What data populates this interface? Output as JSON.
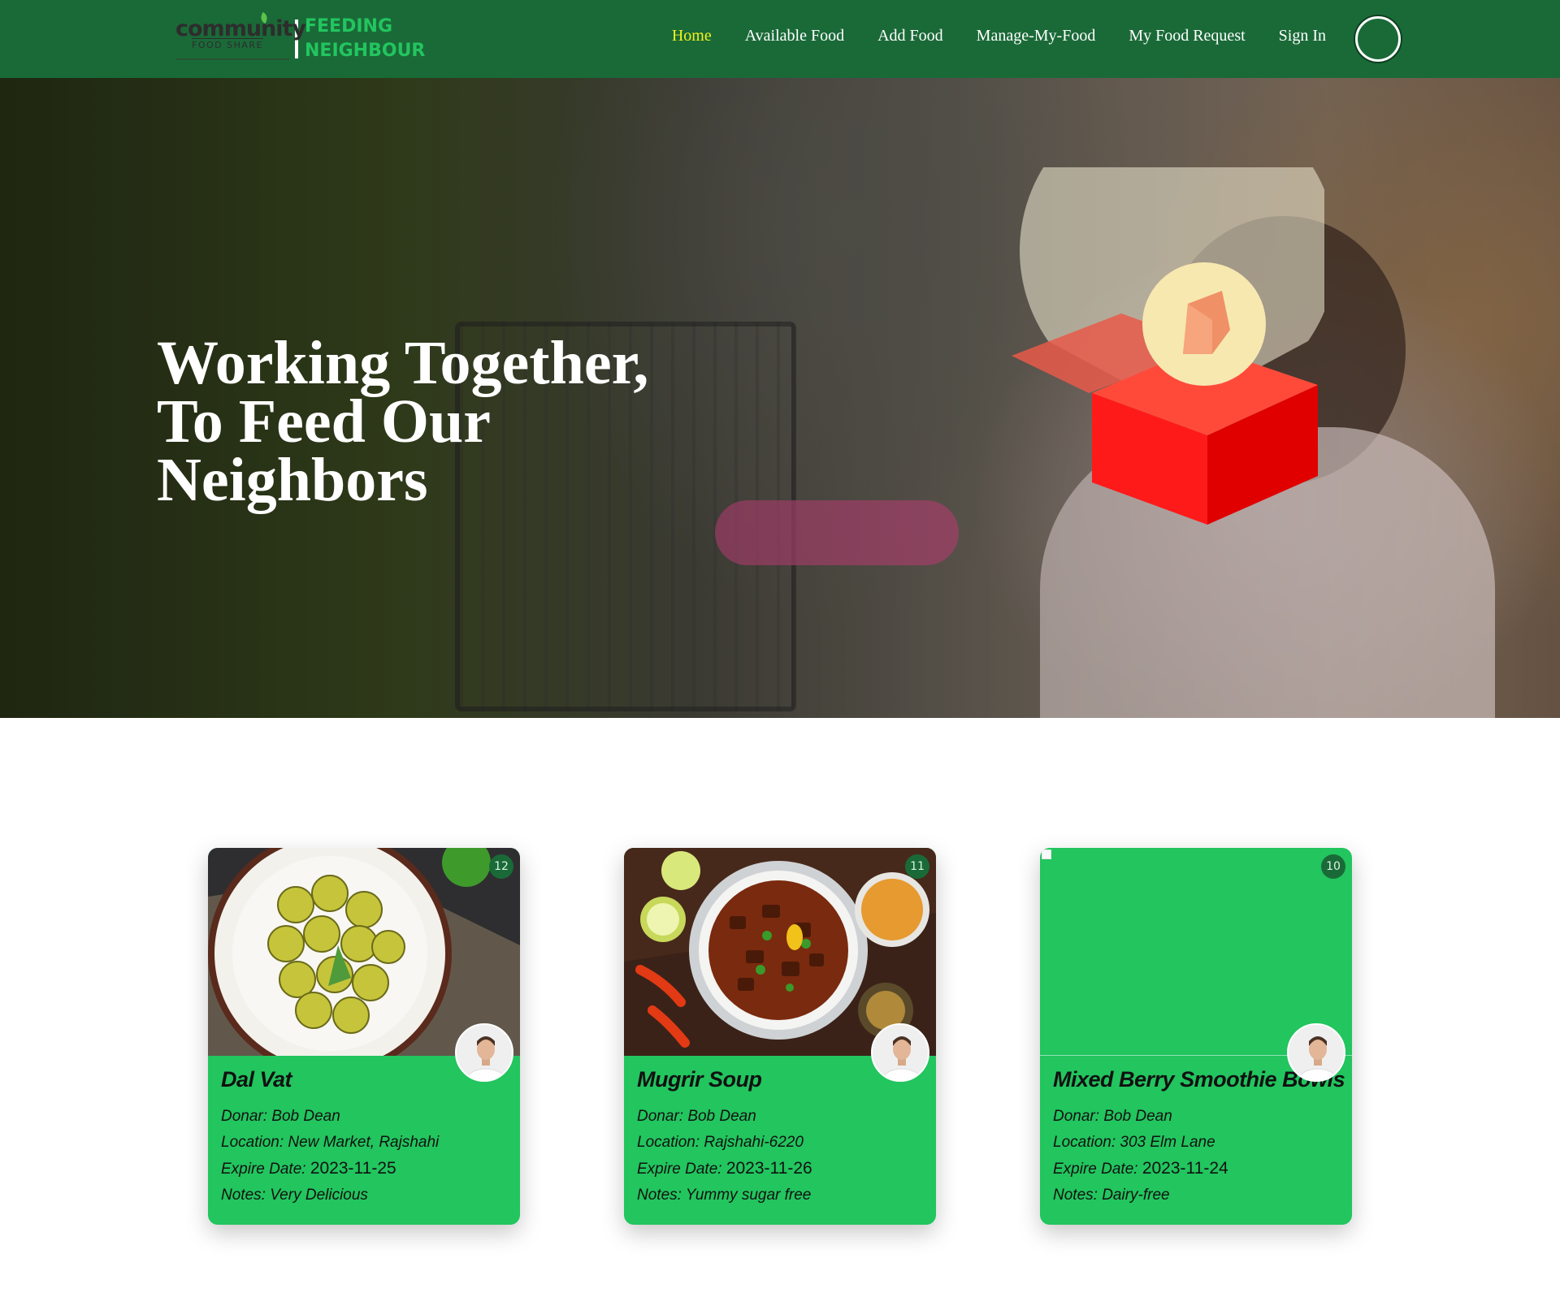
{
  "brand": {
    "logo_word": "community",
    "logo_sub": "FOOD SHARE",
    "title_line1": "FEEDING",
    "title_line2": "NEIGHBOUR"
  },
  "nav": {
    "items": [
      {
        "label": "Home",
        "active": true
      },
      {
        "label": "Available Food"
      },
      {
        "label": "Add Food"
      },
      {
        "label": "Manage-My-Food"
      },
      {
        "label": "My Food Request"
      },
      {
        "label": "Sign In"
      }
    ]
  },
  "hero": {
    "title_line1": "Working Together,",
    "title_line2": "To Feed Our",
    "title_line3": "Neighbors",
    "illustration_icon": "donation-box-icon"
  },
  "foods": [
    {
      "quantity": "12",
      "name": "Dal Vat",
      "donor_label": "Donar:",
      "donor": "Bob Dean",
      "location_label": "Location:",
      "location": "New Market, Rajshahi",
      "expire_label": "Expire Date:",
      "expire": "2023-11-25",
      "notes_label": "Notes:",
      "notes": "Very Delicious"
    },
    {
      "quantity": "11",
      "name": "Mugrir Soup",
      "donor_label": "Donar:",
      "donor": "Bob Dean",
      "location_label": "Location:",
      "location": "Rajshahi-6220",
      "expire_label": "Expire Date:",
      "expire": "2023-11-26",
      "notes_label": "Notes:",
      "notes": "Yummy sugar free"
    },
    {
      "quantity": "10",
      "name": "Mixed Berry Smoothie Bowls",
      "donor_label": "Donar:",
      "donor": "Bob Dean",
      "location_label": "Location:",
      "location": "303 Elm Lane",
      "expire_label": "Expire Date:",
      "expire": "2023-11-24",
      "notes_label": "Notes:",
      "notes": "Dairy-free"
    }
  ],
  "colors": {
    "navbar": "#1a6a38",
    "brand_green": "#22c55e",
    "active_nav": "#f2f21c",
    "card_bg": "#22c55e"
  }
}
